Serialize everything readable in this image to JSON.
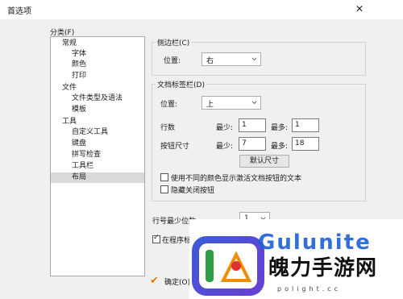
{
  "window": {
    "title": "首选项"
  },
  "sidebar": {
    "label": "分类(F)",
    "items": [
      {
        "label": "常规",
        "level": 0
      },
      {
        "label": "字体",
        "level": 1
      },
      {
        "label": "颜色",
        "level": 1
      },
      {
        "label": "打印",
        "level": 1
      },
      {
        "label": "文件",
        "level": 0
      },
      {
        "label": "文件类型及语法",
        "level": 1
      },
      {
        "label": "模板",
        "level": 1
      },
      {
        "label": "工具",
        "level": 0
      },
      {
        "label": "自定义工具",
        "level": 1
      },
      {
        "label": "键盘",
        "level": 1
      },
      {
        "label": "拼写检查",
        "level": 1
      },
      {
        "label": "工具栏",
        "level": 1
      },
      {
        "label": "布局",
        "level": 1,
        "selected": true
      }
    ]
  },
  "sidebar_group": {
    "legend": "侧边栏(C)",
    "position_label": "位置:",
    "position_value": "右"
  },
  "tabs_group": {
    "legend": "文档标签栏(D)",
    "position_label": "位置:",
    "position_value": "上",
    "rows_label": "行数",
    "rows_min_label": "最少:",
    "rows_min": "1",
    "rows_max_label": "最多:",
    "rows_max": "1",
    "btnsize_label": "按钮尺寸",
    "btn_min_label": "最少:",
    "btn_min": "7",
    "btn_max_label": "最多:",
    "btn_max": "18",
    "default_size_button": "默认尺寸",
    "chk_color_label": "使用不同的颜色显示激活文档按钮的文本",
    "chk_color_checked": false,
    "chk_hide_close_label": "隐藏关闭按钮",
    "chk_hide_close_checked": false
  },
  "line_number": {
    "label": "行号最少位数:",
    "value": "1"
  },
  "program_option": {
    "label": "在程序标",
    "checked": true
  },
  "footer": {
    "ok_label": "确定(O)"
  },
  "watermark": {
    "top_text": "Gulunite",
    "main_text": "魄力手游网",
    "sub_text": "polight.cc"
  },
  "colors": {
    "window_bg": "#f0f0f0",
    "watermark_blue": "#1e5fd6",
    "ok_check": "#e07a00"
  }
}
